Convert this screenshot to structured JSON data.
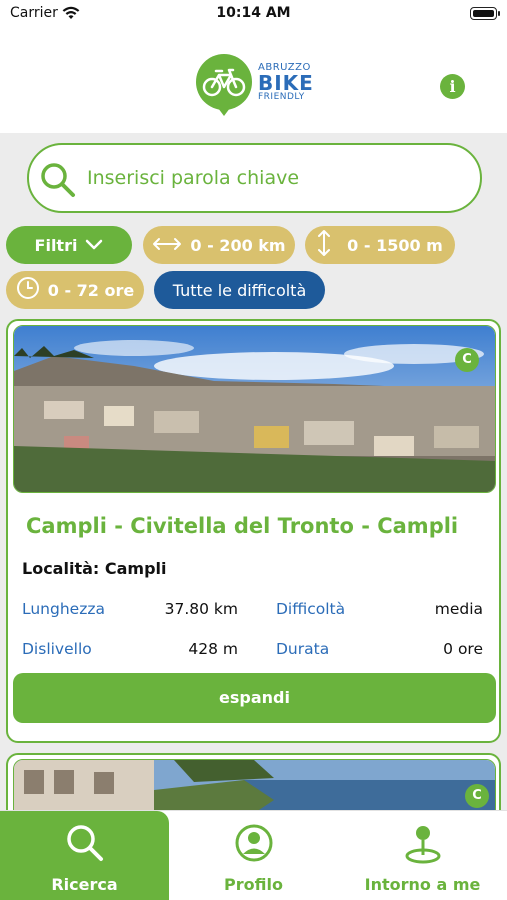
{
  "status_bar": {
    "carrier": "Carrier",
    "time": "10:14 AM"
  },
  "header": {
    "logo": {
      "line1": "ABRUZZO",
      "line2": "BIKE",
      "line3": "FRIENDLY"
    },
    "info_icon": "info-icon"
  },
  "search": {
    "placeholder": "Inserisci parola chiave",
    "icon": "search-icon"
  },
  "filters": {
    "filtri_label": "Filtri",
    "distance": "0 - 200 km",
    "elevation": "0 - 1500 m",
    "duration": "0 - 72 ore",
    "difficulty": "Tutte le difficoltà"
  },
  "routes": [
    {
      "badge": "C",
      "title": "Campli - Civitella del Tronto - Campli",
      "location": "Località: Campli",
      "stats": {
        "lunghezza_label": "Lunghezza",
        "lunghezza_value": "37.80 km",
        "difficolta_label": "Difficoltà",
        "difficolta_value": "media",
        "dislivello_label": "Dislivello",
        "dislivello_value": "428 m",
        "durata_label": "Durata",
        "durata_value": "0 ore"
      },
      "expand_label": "espandi"
    },
    {
      "badge": "C"
    }
  ],
  "tabbar": {
    "tabs": [
      {
        "label": "Ricerca",
        "icon": "search-icon",
        "active": true
      },
      {
        "label": "Profilo",
        "icon": "profile-icon",
        "active": false
      },
      {
        "label": "Intorno a me",
        "icon": "location-pin-icon",
        "active": false
      }
    ]
  },
  "colors": {
    "brand_green": "#6ab33d",
    "gold": "#d9c16e",
    "blue": "#1e5a9a",
    "label_blue": "#2b6cb8"
  }
}
